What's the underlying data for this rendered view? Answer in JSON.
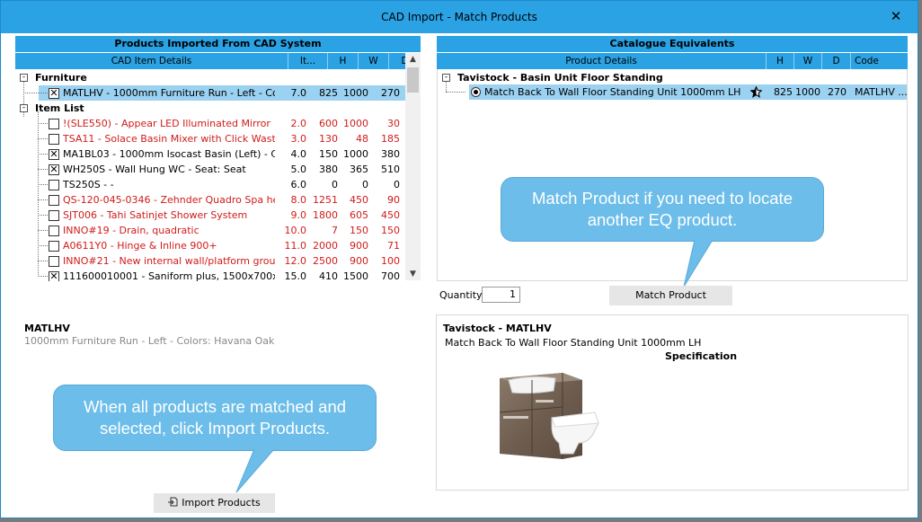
{
  "window": {
    "title": "CAD Import - Match Products",
    "close_glyph": "✕"
  },
  "left": {
    "header": "Products Imported From CAD System",
    "columns": [
      "CAD Item Details",
      "It...",
      "H",
      "W",
      "D"
    ],
    "groups": [
      {
        "label": "Furniture",
        "expander": "-"
      },
      {
        "label": "Item List",
        "expander": "-"
      }
    ],
    "rows": [
      {
        "checked": true,
        "red": false,
        "selected": true,
        "name": "MATLHV - 1000mm Furniture Run - Left - Color...",
        "it": "7.0",
        "h": "825",
        "w": "1000",
        "d": "270"
      },
      {
        "checked": false,
        "red": true,
        "selected": false,
        "name": "!(SLE550) - Appear LED Illuminated Mirror",
        "it": "2.0",
        "h": "600",
        "w": "1000",
        "d": "30"
      },
      {
        "checked": false,
        "red": true,
        "selected": false,
        "name": "TSA11 - Solace Basin Mixer with Click Waste",
        "it": "3.0",
        "h": "130",
        "w": "48",
        "d": "185"
      },
      {
        "checked": true,
        "red": false,
        "selected": false,
        "name": "MA1BL03 - 1000mm Isocast Basin (Left) - Col...",
        "it": "4.0",
        "h": "150",
        "w": "1000",
        "d": "380"
      },
      {
        "checked": true,
        "red": false,
        "selected": false,
        "name": "WH250S - Wall Hung WC - Seat: Seat",
        "it": "5.0",
        "h": "380",
        "w": "365",
        "d": "510"
      },
      {
        "checked": false,
        "red": false,
        "selected": false,
        "name": "TS250S - -",
        "it": "6.0",
        "h": "0",
        "w": "0",
        "d": "0"
      },
      {
        "checked": false,
        "red": true,
        "selected": false,
        "name": "QS-120-045-0346 - Zehnder Quadro Spa heat...",
        "it": "8.0",
        "h": "1251",
        "w": "450",
        "d": "90"
      },
      {
        "checked": false,
        "red": true,
        "selected": false,
        "name": "SJT006 - Tahi Satinjet Shower System",
        "it": "9.0",
        "h": "1800",
        "w": "605",
        "d": "450"
      },
      {
        "checked": false,
        "red": true,
        "selected": false,
        "name": "INNO#19 - Drain, quadratic",
        "it": "10.0",
        "h": "7",
        "w": "150",
        "d": "150"
      },
      {
        "checked": false,
        "red": true,
        "selected": false,
        "name": "A0611Y0 - Hinge & Inline 900+",
        "it": "11.0",
        "h": "2000",
        "w": "900",
        "d": "71"
      },
      {
        "checked": false,
        "red": true,
        "selected": false,
        "name": "INNO#21 - New internal wall/platform group",
        "it": "12.0",
        "h": "2500",
        "w": "900",
        "d": "100"
      },
      {
        "checked": true,
        "red": false,
        "selected": false,
        "name": "111600010001 - Saniform plus, 1500x700x4...",
        "it": "15.0",
        "h": "410",
        "w": "1500",
        "d": "700"
      }
    ],
    "detail_code": "MATLHV",
    "detail_desc": "1000mm Furniture Run - Left - Colors: Havana Oak"
  },
  "right": {
    "header": "Catalogue Equivalents",
    "columns": [
      "Product Details",
      "H",
      "W",
      "D",
      "Code"
    ],
    "group": {
      "label": "Tavistock - Basin Unit Floor Standing",
      "expander": "-"
    },
    "rows": [
      {
        "name": "Match Back To Wall Floor Standing Unit 1000mm LH",
        "h": "825",
        "w": "1000",
        "d": "270",
        "code": "MATLHV ..."
      }
    ],
    "detail_title": "Tavistock - MATLHV",
    "detail_desc": "Match Back To Wall Floor Standing Unit 1000mm LH",
    "spec_label": "Specification"
  },
  "quantity": {
    "label": "Quantity",
    "value": "1"
  },
  "buttons": {
    "match_product": "Match Product",
    "import_products": "Import Products"
  },
  "tips": {
    "match": "Match Product if you need to locate another EQ product.",
    "import": "When all products are matched and selected, click Import Products."
  },
  "icons": {
    "star": "star-icon",
    "import": "import-icon",
    "close": "close-icon",
    "scroll_up": "▲",
    "scroll_down": "▼"
  },
  "colors": {
    "header_blue": "#2aa2e4",
    "selected_row": "#9bd1f1",
    "bubble": "#6cbde9",
    "missing_red": "#d21a1a"
  }
}
